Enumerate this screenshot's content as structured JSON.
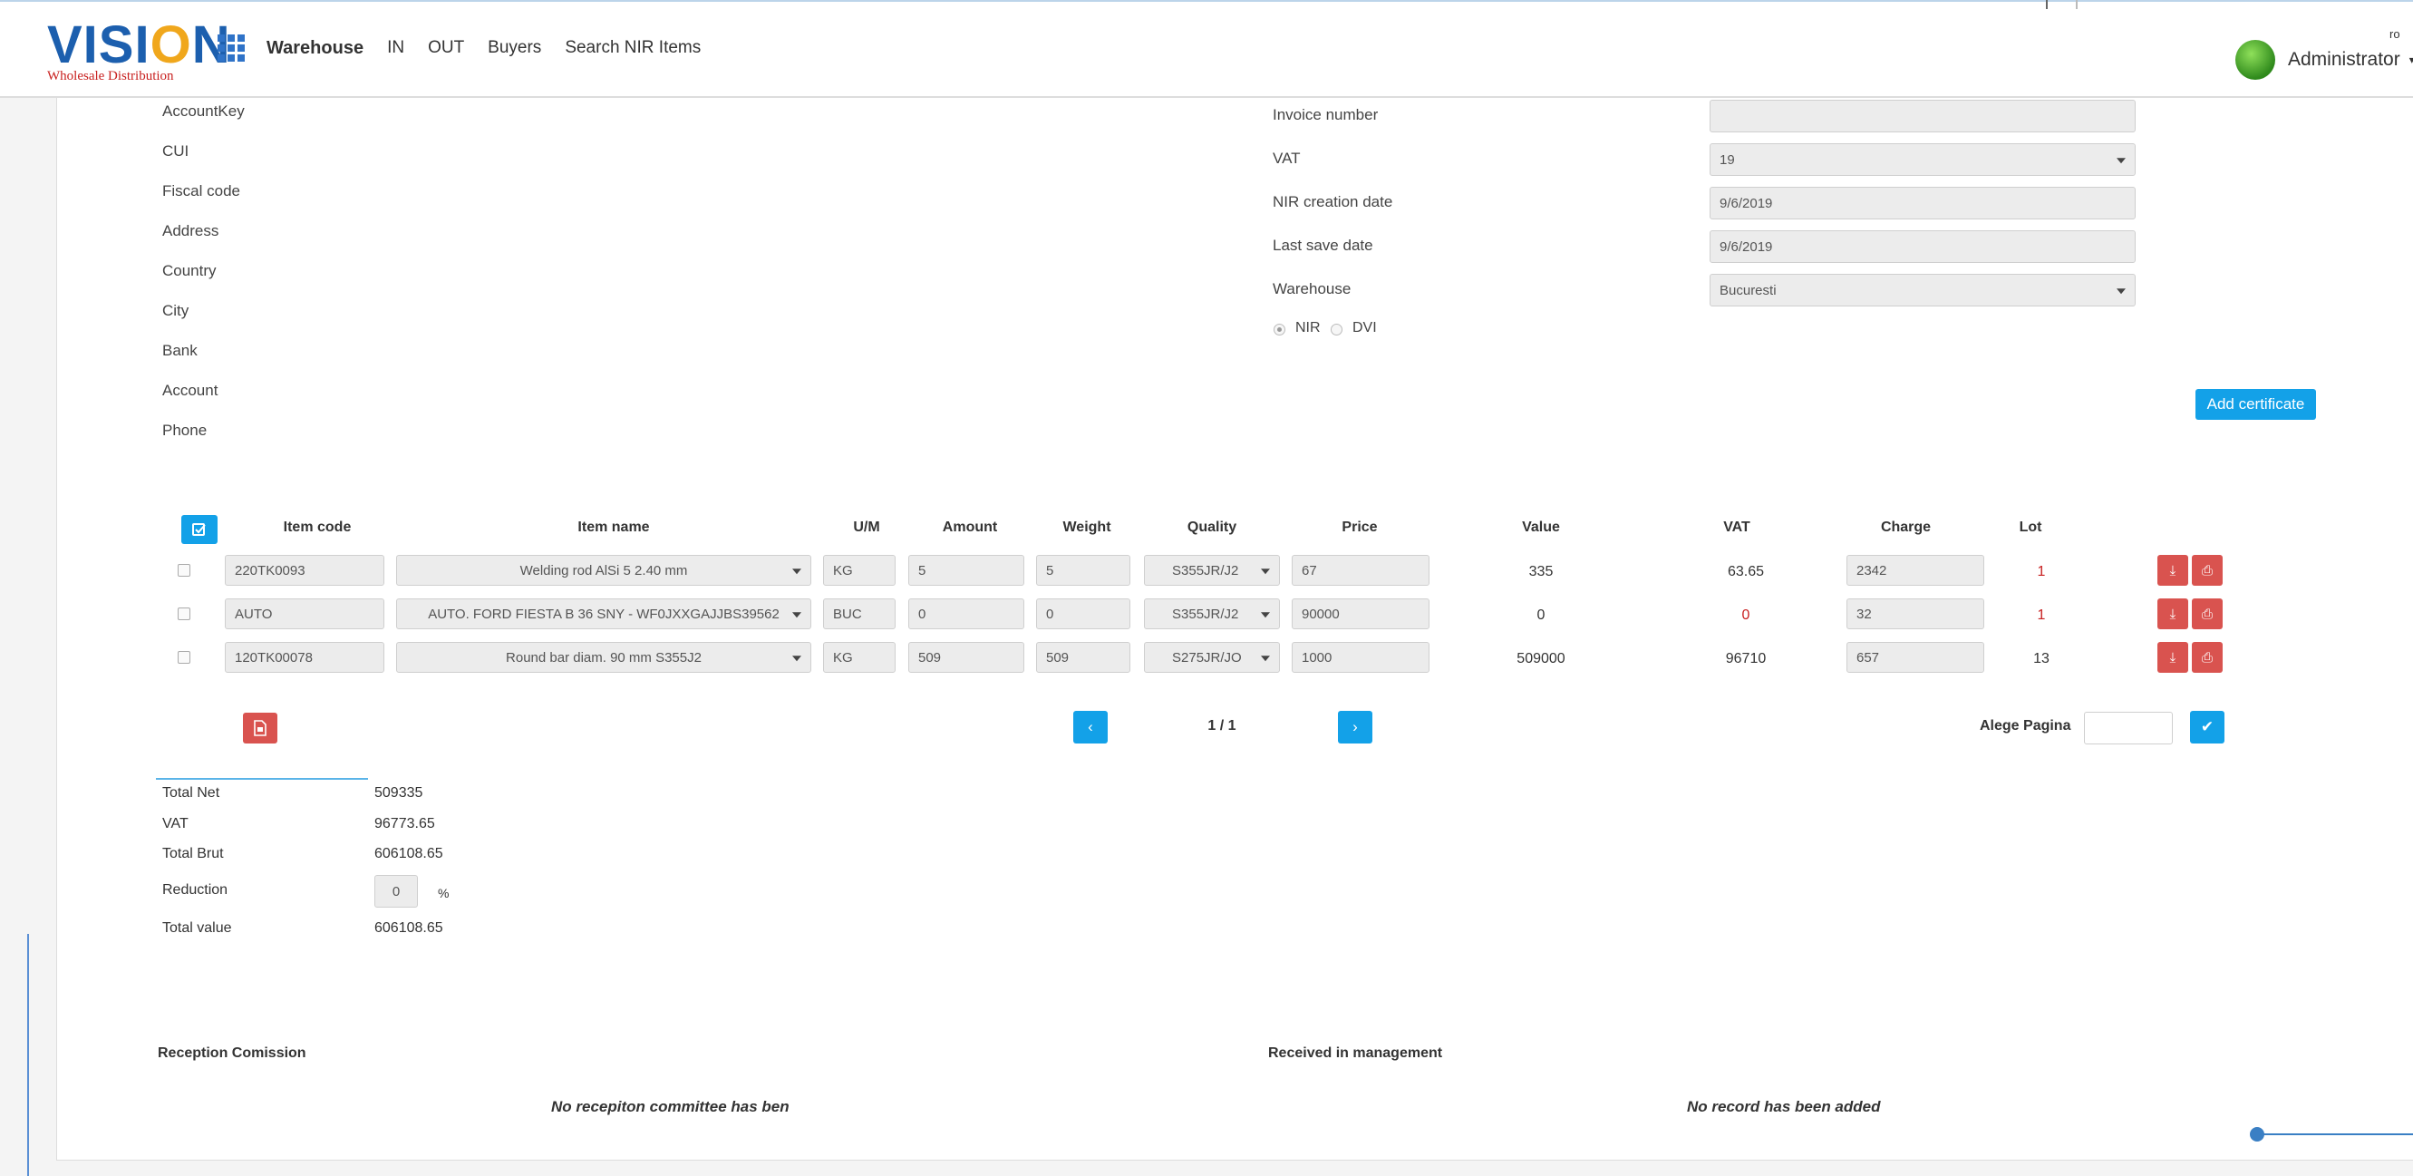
{
  "logo": {
    "title": "VISION",
    "subtitle": "Wholesale Distribution"
  },
  "nav": {
    "items": [
      "Warehouse",
      "IN",
      "OUT",
      "Buyers",
      "Search NIR Items"
    ]
  },
  "user": {
    "name": "Administrator",
    "lang": "ro"
  },
  "supplier_labels": [
    "AccountKey",
    "CUI",
    "Fiscal code",
    "Address",
    "Country",
    "City",
    "Bank",
    "Account",
    "Phone"
  ],
  "invoice": {
    "invoice_number_label": "Invoice number",
    "invoice_number_value": "",
    "vat_label": "VAT",
    "vat_value": "19",
    "nir_creation_label": "NIR creation date",
    "nir_creation_value": "9/6/2019",
    "last_save_label": "Last save date",
    "last_save_value": "9/6/2019",
    "warehouse_label": "Warehouse",
    "warehouse_value": "Bucuresti",
    "radio_nir": "NIR",
    "radio_dvi": "DVI"
  },
  "add_certificate": "Add certificate",
  "table": {
    "headers": [
      "Item code",
      "Item name",
      "U/M",
      "Amount",
      "Weight",
      "Quality",
      "Price",
      "Value",
      "VAT",
      "Charge",
      "Lot"
    ],
    "rows": [
      {
        "code": "220TK0093",
        "name": "Welding rod AlSi 5 2.40 mm",
        "um": "KG",
        "amount": "5",
        "weight": "5",
        "quality": "S355JR/J2",
        "price": "67",
        "value": "335",
        "vat": "63.65",
        "charge": "2342",
        "lot": "1"
      },
      {
        "code": "AUTO",
        "name": "AUTO. FORD FIESTA B 36 SNY - WF0JXXGAJJBS39562",
        "um": "BUC",
        "amount": "0",
        "weight": "0",
        "quality": "S355JR/J2",
        "price": "90000",
        "value": "0",
        "vat": "0",
        "charge": "32",
        "lot": "1"
      },
      {
        "code": "120TK00078",
        "name": "Round bar diam. 90 mm S355J2",
        "um": "KG",
        "amount": "509",
        "weight": "509",
        "quality": "S275JR/JO",
        "price": "1000",
        "value": "509000",
        "vat": "96710",
        "charge": "657",
        "lot": "13"
      }
    ]
  },
  "pagination": {
    "page": "1 / 1",
    "goto_label": "Alege Pagina",
    "goto_value": ""
  },
  "totals": {
    "total_net_label": "Total Net",
    "total_net": "509335",
    "vat_label": "VAT",
    "vat": "96773.65",
    "total_brut_label": "Total Brut",
    "total_brut": "606108.65",
    "reduction_label": "Reduction",
    "reduction": "0",
    "reduction_unit": "%",
    "total_value_label": "Total value",
    "total_value": "606108.65"
  },
  "sections": {
    "reception_title": "Reception Comission",
    "reception_empty": "No recepiton committee has ben",
    "received_title": "Received in management",
    "received_empty": "No record has been added"
  },
  "colors": {
    "accent": "#13a1e8",
    "danger": "#d9534f",
    "brand_blue": "#1c5fae",
    "brand_orange": "#f0a71c",
    "brand_red": "#c8201f"
  },
  "icons": [
    "apps-grid-icon",
    "checklist-icon",
    "download-icon",
    "print-icon",
    "pdf-icon",
    "chevron-left-icon",
    "chevron-right-icon",
    "check-icon"
  ]
}
